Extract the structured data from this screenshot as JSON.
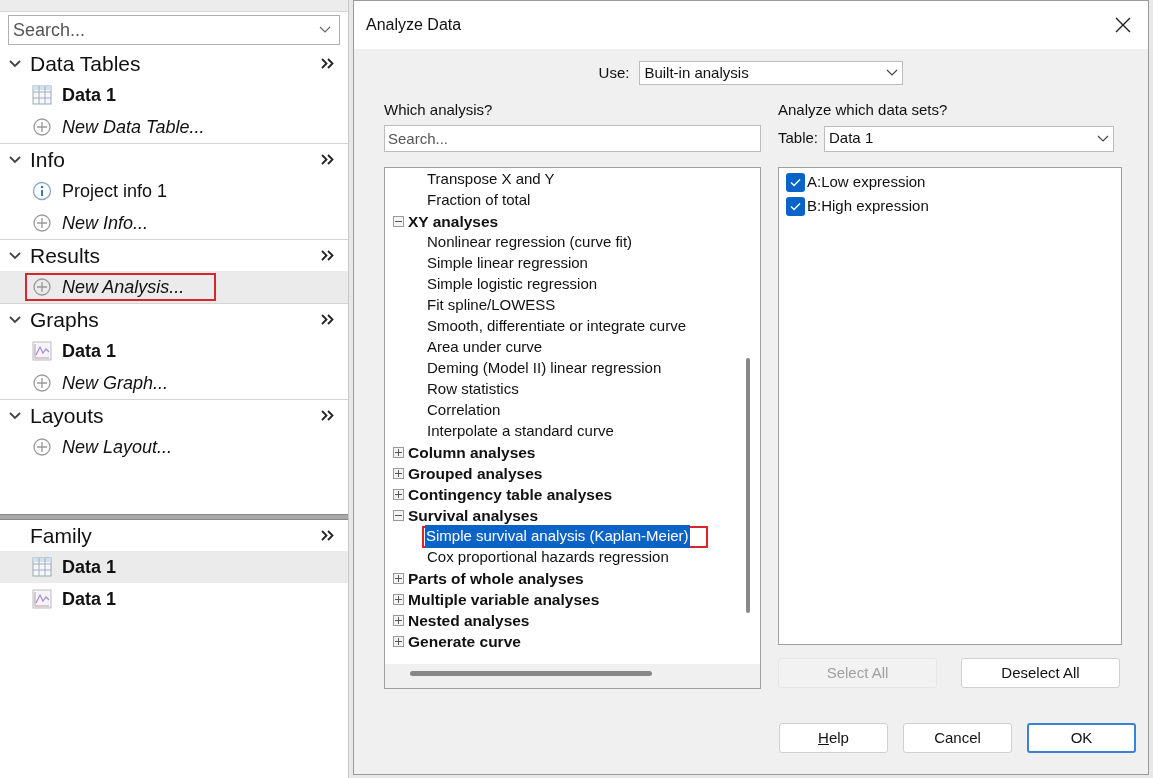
{
  "navigator": {
    "search": {
      "placeholder": "Search..."
    },
    "sections": [
      {
        "title": "Data Tables",
        "expanded": true,
        "items": [
          {
            "kind": "table",
            "label": "Data 1",
            "selected": false,
            "annotated": false
          },
          {
            "kind": "add",
            "label": "New Data Table...",
            "selected": false,
            "annotated": false
          }
        ]
      },
      {
        "title": "Info",
        "expanded": true,
        "items": [
          {
            "kind": "info",
            "label": "Project info 1",
            "selected": false,
            "annotated": false
          },
          {
            "kind": "add",
            "label": "New Info...",
            "selected": false,
            "annotated": false
          }
        ]
      },
      {
        "title": "Results",
        "expanded": true,
        "items": [
          {
            "kind": "add",
            "label": "New Analysis...",
            "selected": true,
            "annotated": true
          }
        ]
      },
      {
        "title": "Graphs",
        "expanded": true,
        "items": [
          {
            "kind": "graph",
            "label": "Data 1",
            "selected": false,
            "annotated": false
          },
          {
            "kind": "add",
            "label": "New Graph...",
            "selected": false,
            "annotated": false
          }
        ]
      },
      {
        "title": "Layouts",
        "expanded": true,
        "items": [
          {
            "kind": "add",
            "label": "New Layout...",
            "selected": false,
            "annotated": false
          }
        ]
      }
    ],
    "family": {
      "title": "Family",
      "items": [
        {
          "kind": "table",
          "label": "Data 1",
          "selected": true
        },
        {
          "kind": "graph",
          "label": "Data 1",
          "selected": false
        }
      ]
    }
  },
  "dialog": {
    "title": "Analyze Data",
    "use": {
      "label": "Use:",
      "value": "Built-in analysis"
    },
    "which_analysis": {
      "heading": "Which analysis?",
      "search": {
        "placeholder": "Search..."
      },
      "tree": [
        {
          "kind": "item",
          "label": "Transpose X and Y",
          "selected": false,
          "annotated": false
        },
        {
          "kind": "item",
          "label": "Fraction of total",
          "selected": false,
          "annotated": false
        },
        {
          "kind": "group",
          "label": "XY analyses",
          "expanded": true,
          "children": [
            {
              "kind": "item",
              "label": "Nonlinear regression (curve fit)",
              "selected": false,
              "annotated": false
            },
            {
              "kind": "item",
              "label": "Simple linear regression",
              "selected": false,
              "annotated": false
            },
            {
              "kind": "item",
              "label": "Simple logistic regression",
              "selected": false,
              "annotated": false
            },
            {
              "kind": "item",
              "label": "Fit spline/LOWESS",
              "selected": false,
              "annotated": false
            },
            {
              "kind": "item",
              "label": "Smooth, differentiate or integrate curve",
              "selected": false,
              "annotated": false
            },
            {
              "kind": "item",
              "label": "Area under curve",
              "selected": false,
              "annotated": false
            },
            {
              "kind": "item",
              "label": "Deming (Model II) linear regression",
              "selected": false,
              "annotated": false
            },
            {
              "kind": "item",
              "label": "Row statistics",
              "selected": false,
              "annotated": false
            },
            {
              "kind": "item",
              "label": "Correlation",
              "selected": false,
              "annotated": false
            },
            {
              "kind": "item",
              "label": "Interpolate a standard curve",
              "selected": false,
              "annotated": false
            }
          ]
        },
        {
          "kind": "group",
          "label": "Column analyses",
          "expanded": false
        },
        {
          "kind": "group",
          "label": "Grouped analyses",
          "expanded": false
        },
        {
          "kind": "group",
          "label": "Contingency table analyses",
          "expanded": false
        },
        {
          "kind": "group",
          "label": "Survival analyses",
          "expanded": true,
          "children": [
            {
              "kind": "item",
              "label": "Simple survival analysis (Kaplan-Meier)",
              "selected": true,
              "annotated": true
            },
            {
              "kind": "item",
              "label": "Cox proportional hazards regression",
              "selected": false,
              "annotated": false
            }
          ]
        },
        {
          "kind": "group",
          "label": "Parts of whole analyses",
          "expanded": false
        },
        {
          "kind": "group",
          "label": "Multiple variable analyses",
          "expanded": false
        },
        {
          "kind": "group",
          "label": "Nested analyses",
          "expanded": false
        },
        {
          "kind": "group",
          "label": "Generate curve",
          "expanded": false
        }
      ]
    },
    "data_sets": {
      "heading": "Analyze which data sets?",
      "table_label": "Table:",
      "table_value": "Data 1",
      "items": [
        {
          "label": "A:Low expression",
          "checked": true
        },
        {
          "label": "B:High expression",
          "checked": true
        }
      ],
      "select_buttons": [
        {
          "label": "Select All",
          "disabled": true
        },
        {
          "label": "Deselect All",
          "disabled": false
        }
      ]
    },
    "buttons": [
      {
        "label": "Help",
        "mnemonic": true,
        "default": false
      },
      {
        "label": "Cancel",
        "mnemonic": false,
        "default": false
      },
      {
        "label": "OK",
        "mnemonic": false,
        "default": true
      }
    ]
  }
}
